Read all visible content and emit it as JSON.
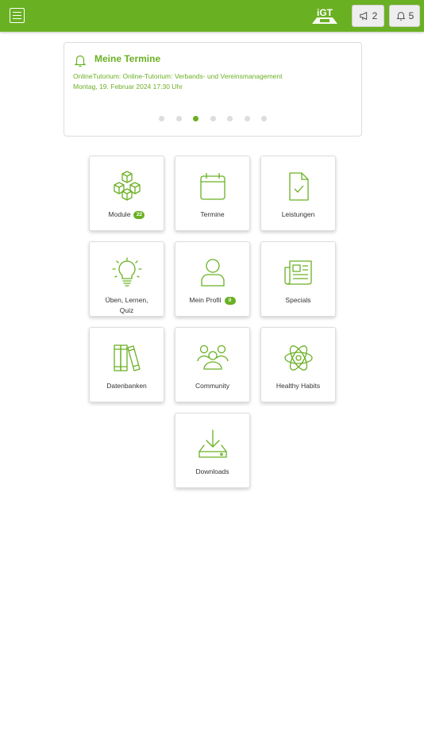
{
  "header": {
    "menu_icon": "hamburger-icon",
    "logo_text": "iGT",
    "announcements_count": "2",
    "notifications_count": "5",
    "accent_color": "#6ab023"
  },
  "appointments": {
    "title": "Meine Termine",
    "event": "OnlineTutorium: Online-Tutorium: Verbands- und Vereinsmanagement",
    "datetime": "Montag, 19. Februar 2024 17:30 Uhr",
    "pager_count": 7,
    "pager_active": 3
  },
  "tiles": {
    "module": {
      "label": "Module",
      "badge": "22",
      "icon": "cubes-icon"
    },
    "termine": {
      "label": "Termine",
      "icon": "calendar-icon"
    },
    "leistungen": {
      "label": "Leistungen",
      "icon": "document-check-icon"
    },
    "ueben": {
      "label_line1": "Üben, Lernen,",
      "label_line2": "Quiz",
      "icon": "lightbulb-icon"
    },
    "profil": {
      "label": "Mein Profil",
      "badge": "0",
      "icon": "user-icon"
    },
    "specials": {
      "label": "Specials",
      "icon": "newspaper-icon"
    },
    "datenbanken": {
      "label": "Datenbanken",
      "icon": "books-icon"
    },
    "community": {
      "label": "Community",
      "icon": "group-icon"
    },
    "healthy": {
      "label": "Healthy Habits",
      "icon": "atom-icon"
    },
    "downloads": {
      "label": "Downloads",
      "icon": "download-icon"
    }
  }
}
